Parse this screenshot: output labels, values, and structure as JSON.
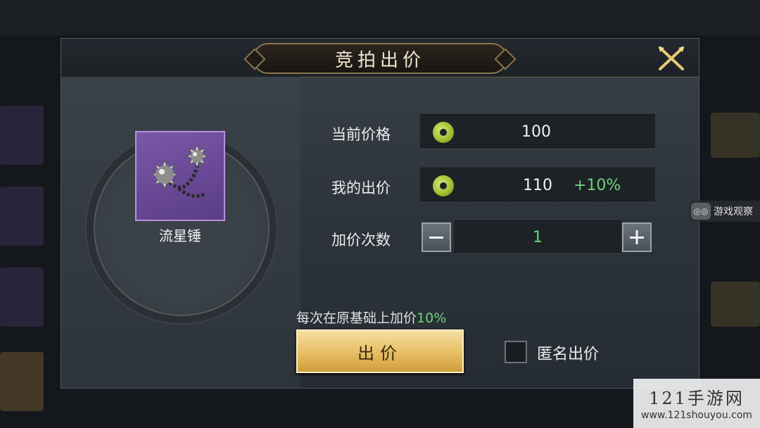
{
  "dialog": {
    "title": "竞拍出价",
    "item_name": "流星锤",
    "current_price_label": "当前价格",
    "current_price": "100",
    "my_bid_label": "我的出价",
    "my_bid": "110",
    "my_bid_increase": "+10%",
    "raise_count_label": "加价次数",
    "raise_count": "1",
    "hint_text": "每次在原基础上加价",
    "hint_percent": "10%",
    "bid_button": "出价",
    "anonymous_label": "匿名出价",
    "anonymous_checked": false
  },
  "side_badge": {
    "text": "游戏观察"
  },
  "watermark": {
    "title": "121手游网",
    "url": "www.121shouyou.com"
  },
  "colors": {
    "accent_gold": "#e6bd62",
    "green_text": "#6ed47a",
    "item_rarity_purple": "#7a58a8"
  },
  "icons": [
    "close-icon",
    "coin-icon",
    "minus-icon",
    "plus-icon",
    "meteor-hammer-icon"
  ]
}
